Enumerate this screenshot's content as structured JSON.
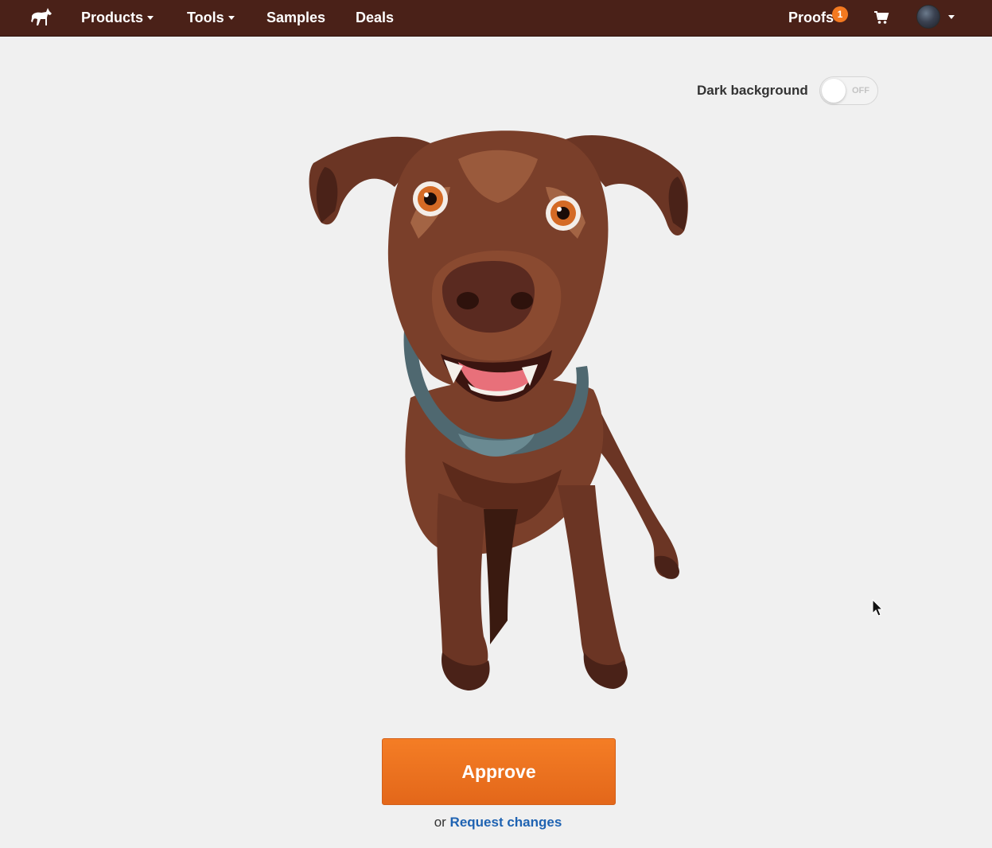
{
  "nav": {
    "logo_icon": "horse-logo-icon",
    "items": [
      {
        "label": "Products",
        "dropdown": true
      },
      {
        "label": "Tools",
        "dropdown": true
      },
      {
        "label": "Samples",
        "dropdown": false
      },
      {
        "label": "Deals",
        "dropdown": false
      }
    ],
    "proofs_label": "Proofs",
    "proofs_count": "1",
    "cart_icon": "cart-icon",
    "avatar_icon": "user-avatar"
  },
  "toolbar": {
    "dark_background_label": "Dark background",
    "toggle_state": "OFF"
  },
  "proof": {
    "image": "dog-illustration"
  },
  "actions": {
    "approve_label": "Approve",
    "or_text": "or",
    "request_changes_label": "Request changes"
  },
  "colors": {
    "nav_bg": "#4a2118",
    "accent": "#f47920",
    "link": "#1f63b2",
    "page_bg": "#f0f0f0"
  }
}
